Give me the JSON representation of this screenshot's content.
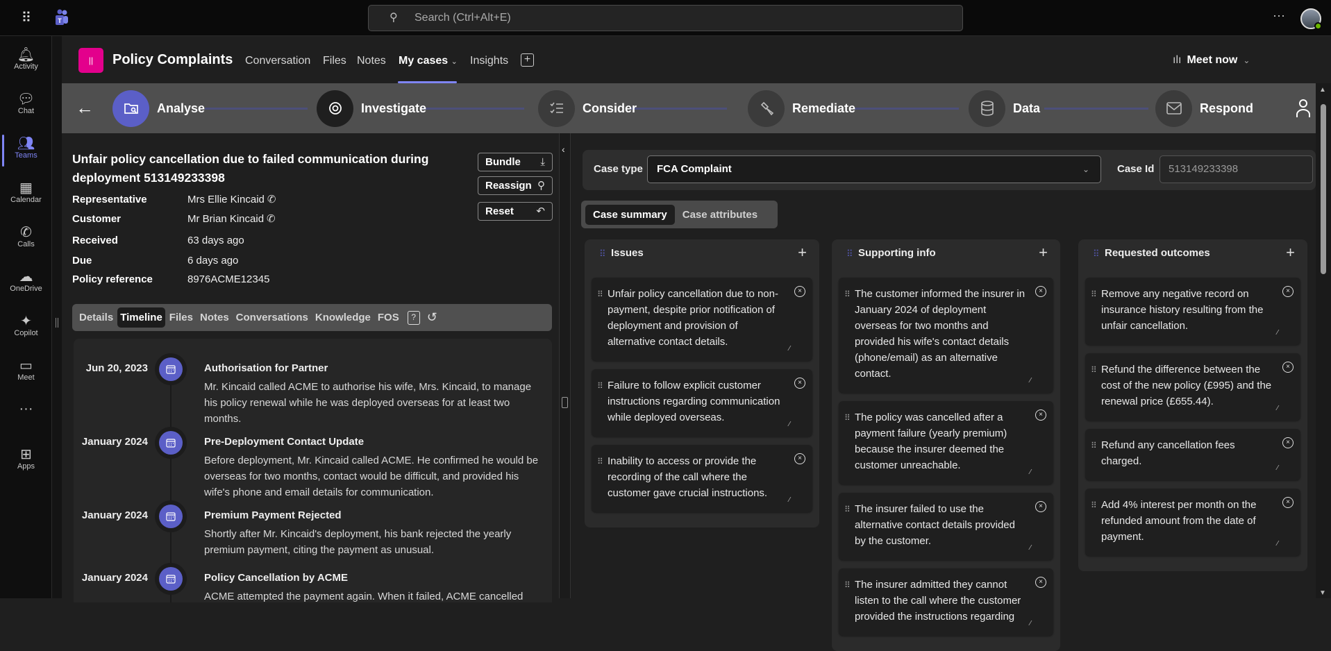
{
  "topbar": {
    "search_placeholder": "Search (Ctrl+Alt+E)",
    "more": "···"
  },
  "rail": [
    {
      "label": "Activity",
      "icon": "bell-icon",
      "glyph": "🔔︎"
    },
    {
      "label": "Chat",
      "icon": "chat-icon",
      "glyph": "💬︎"
    },
    {
      "label": "Teams",
      "icon": "teams-icon",
      "glyph": "👥︎",
      "active": true
    },
    {
      "label": "Calendar",
      "icon": "calendar-icon",
      "glyph": "▦"
    },
    {
      "label": "Calls",
      "icon": "phone-icon",
      "glyph": "✆"
    },
    {
      "label": "OneDrive",
      "icon": "cloud-icon",
      "glyph": "☁"
    },
    {
      "label": "Copilot",
      "icon": "copilot-icon",
      "glyph": "✦"
    },
    {
      "label": "Meet",
      "icon": "video-icon",
      "glyph": "▭"
    },
    {
      "label": "",
      "icon": "more-icon",
      "glyph": "···"
    },
    {
      "label": "Apps",
      "icon": "apps-icon",
      "glyph": "⊞"
    }
  ],
  "header": {
    "logo_text": "||",
    "title": "Policy Complaints",
    "tabs": [
      "Conversation",
      "Files",
      "Notes",
      "My cases",
      "Insights"
    ],
    "active_tab": "My cases",
    "meet_now": "Meet now"
  },
  "stepper": {
    "steps": [
      {
        "label": "Analyse",
        "icon": "folder-search-icon",
        "state": "done"
      },
      {
        "label": "Investigate",
        "icon": "eye-icon",
        "state": "current"
      },
      {
        "label": "Consider",
        "icon": "checklist-icon",
        "state": "todo"
      },
      {
        "label": "Remediate",
        "icon": "hammer-icon",
        "state": "todo"
      },
      {
        "label": "Data",
        "icon": "database-icon",
        "state": "todo"
      },
      {
        "label": "Respond",
        "icon": "mail-icon",
        "state": "todo"
      }
    ]
  },
  "case": {
    "title": "Unfair policy cancellation due to failed communication during deployment 513149233398",
    "actions": {
      "bundle": "Bundle",
      "reassign": "Reassign",
      "reset": "Reset"
    },
    "details": [
      {
        "label": "Representative",
        "value": "Mrs Ellie Kincaid",
        "phone": true
      },
      {
        "label": "Customer",
        "value": "Mr Brian Kincaid",
        "phone": true
      },
      {
        "label": "Received",
        "value": "63 days ago"
      },
      {
        "label": "Due",
        "value": "6 days ago"
      },
      {
        "label": "Policy reference",
        "value": "8976ACME12345"
      }
    ],
    "tabs": [
      "Details",
      "Timeline",
      "Files",
      "Notes",
      "Conversations",
      "Knowledge",
      "FOS"
    ],
    "active_tab": "Timeline"
  },
  "timeline": [
    {
      "date": "Jun 20, 2023",
      "title": "Authorisation for Partner",
      "body": "Mr. Kincaid called ACME to authorise his wife, Mrs. Kincaid, to manage his policy renewal while he was deployed overseas for at least two months."
    },
    {
      "date": "January 2024",
      "title": "Pre-Deployment Contact Update",
      "body": "Before deployment, Mr. Kincaid called ACME. He confirmed he would be overseas for two months, contact would be difficult, and provided his wife's phone and email details for communication."
    },
    {
      "date": "January 2024",
      "title": "Premium Payment Rejected",
      "body": "Shortly after Mr. Kincaid's deployment, his bank rejected the yearly premium payment, citing the payment as unusual."
    },
    {
      "date": "January 2024",
      "title": "Policy Cancellation by ACME",
      "body": "ACME attempted the payment again. When it failed, ACME cancelled"
    }
  ],
  "summary": {
    "case_type_label": "Case type",
    "case_type_value": "FCA Complaint",
    "case_id_label": "Case Id",
    "case_id_value": "513149233398",
    "tabs": [
      "Case summary",
      "Case attributes"
    ],
    "active_tab": "Case summary",
    "columns": [
      {
        "title": "Issues",
        "cards": [
          "Unfair policy cancellation due to non-payment, despite prior notification of deployment and provision of alternative contact details.",
          "Failure to follow explicit customer instructions regarding communication while deployed overseas.",
          "Inability to access or provide the recording of the call where the customer gave crucial instructions."
        ]
      },
      {
        "title": "Supporting info",
        "cards": [
          "The customer informed the insurer in January 2024 of deployment overseas for two months and provided his wife's contact details (phone/email) as an alternative contact.",
          "The policy was cancelled after a payment failure (yearly premium) because the insurer deemed the customer unreachable.",
          "The insurer failed to use the alternative contact details provided by the customer.",
          "The insurer admitted they cannot listen to the call where the customer provided the instructions regarding"
        ]
      },
      {
        "title": "Requested outcomes",
        "cards": [
          "Remove any negative record on insurance history resulting from the unfair cancellation.",
          "Refund the difference between the cost of the new policy (£995) and the renewal price (£655.44).",
          "Refund any cancellation fees charged.",
          "Add 4% interest per month on the refunded amount from the date of payment."
        ]
      }
    ]
  },
  "colors": {
    "accent": "#5b5fc7",
    "brand_logo": "#e3008c"
  }
}
